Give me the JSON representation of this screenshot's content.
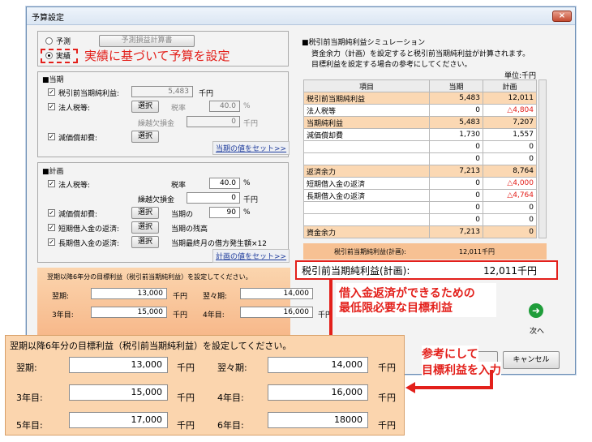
{
  "window": {
    "title": "予算設定",
    "close_icon": "×"
  },
  "mode": {
    "forecast": "予測",
    "actual": "実績",
    "forecast_btn": "予測損益計算書",
    "note": "実績に基づいて予算を設定"
  },
  "current": {
    "title": "■当期",
    "pretax_label": "税引前当期純利益:",
    "pretax_value": "5,483",
    "pretax_unit": "千円",
    "tax_label": "法人税等:",
    "select": "選択",
    "rate_label": "税率",
    "rate_value": "40.0",
    "rate_unit": "%",
    "carry_label": "繰越欠損金",
    "carry_value": "0",
    "carry_unit": "千円",
    "dep_label": "減価償却費:",
    "set_link": "当期の値をセット>>"
  },
  "plan": {
    "title": "■計画",
    "tax_label": "法人税等:",
    "rate_label": "税率",
    "rate_value": "40.0",
    "rate_unit": "%",
    "carry_label": "繰越欠損金",
    "carry_value": "0",
    "carry_unit": "千円",
    "dep_label": "減価償却費:",
    "select": "選択",
    "dep_ratio_label": "当期の",
    "dep_ratio_value": "90",
    "dep_ratio_unit": "%",
    "short_label": "短期借入金の返済:",
    "short_note": "当期の残高",
    "long_label": "長期借入金の返済:",
    "long_note": "当期最終月の借方発生額×12",
    "set_link": "計画の値をセット>>"
  },
  "targets": {
    "instruction": "翌期以降6年分の目標利益（税引前当期純利益）を設定してください。",
    "unit": "千円",
    "items": [
      {
        "label": "翌期:",
        "value": "13,000"
      },
      {
        "label": "翌々期:",
        "value": "14,000"
      },
      {
        "label": "3年目:",
        "value": "15,000"
      },
      {
        "label": "4年目:",
        "value": "16,000"
      },
      {
        "label": "5年目:",
        "value": "17,000"
      },
      {
        "label": "6年目:",
        "value": "18000"
      }
    ]
  },
  "sim": {
    "title": "■税引前当期純利益シミュレーション",
    "desc1": "資金余力（計画）を設定すると税引前当期純利益が計算されます。",
    "desc2": "目標利益を設定する場合の参考にしてください。",
    "unit": "単位:千円",
    "headers": [
      "項目",
      "当期",
      "計画"
    ],
    "rows": [
      {
        "item": "税引前当期純利益",
        "cur": "5,483",
        "plan": "12,011",
        "hl": true
      },
      {
        "item": "法人税等",
        "cur": "0",
        "plan": "△4,804",
        "red": true
      },
      {
        "item": "当期純利益",
        "cur": "5,483",
        "plan": "7,207",
        "hl": true
      },
      {
        "item": "減価償却費",
        "cur": "1,730",
        "plan": "1,557"
      },
      {
        "item": "",
        "cur": "0",
        "plan": "0"
      },
      {
        "item": "",
        "cur": "0",
        "plan": "0"
      },
      {
        "item": "返済余力",
        "cur": "7,213",
        "plan": "8,764",
        "hl": true
      },
      {
        "item": "短期借入金の返済",
        "cur": "0",
        "plan": "△4,000",
        "red": true
      },
      {
        "item": "長期借入金の返済",
        "cur": "0",
        "plan": "△4,764",
        "red": true
      },
      {
        "item": "",
        "cur": "0",
        "plan": "0"
      },
      {
        "item": "",
        "cur": "0",
        "plan": "0"
      },
      {
        "item": "資金余力",
        "cur": "7,213",
        "plan": "0",
        "hl": true
      }
    ],
    "result_small_label": "税引前当期純利益(計画):",
    "result_small_value": "12,011千円",
    "result_label": "税引前当期純利益(計画):",
    "result_value": "12,011千円"
  },
  "callouts": {
    "min_target_1": "借入金返済ができるための",
    "min_target_2": "最低限必要な目標利益",
    "ref_1": "参考にして",
    "ref_2": "目標利益を入力"
  },
  "buttons": {
    "next": "次へ",
    "cancel": "キャンセル"
  },
  "colors": {
    "accent_red": "#e3201b",
    "highlight": "#fbd8b3",
    "overlay": "#fbd5ae"
  }
}
